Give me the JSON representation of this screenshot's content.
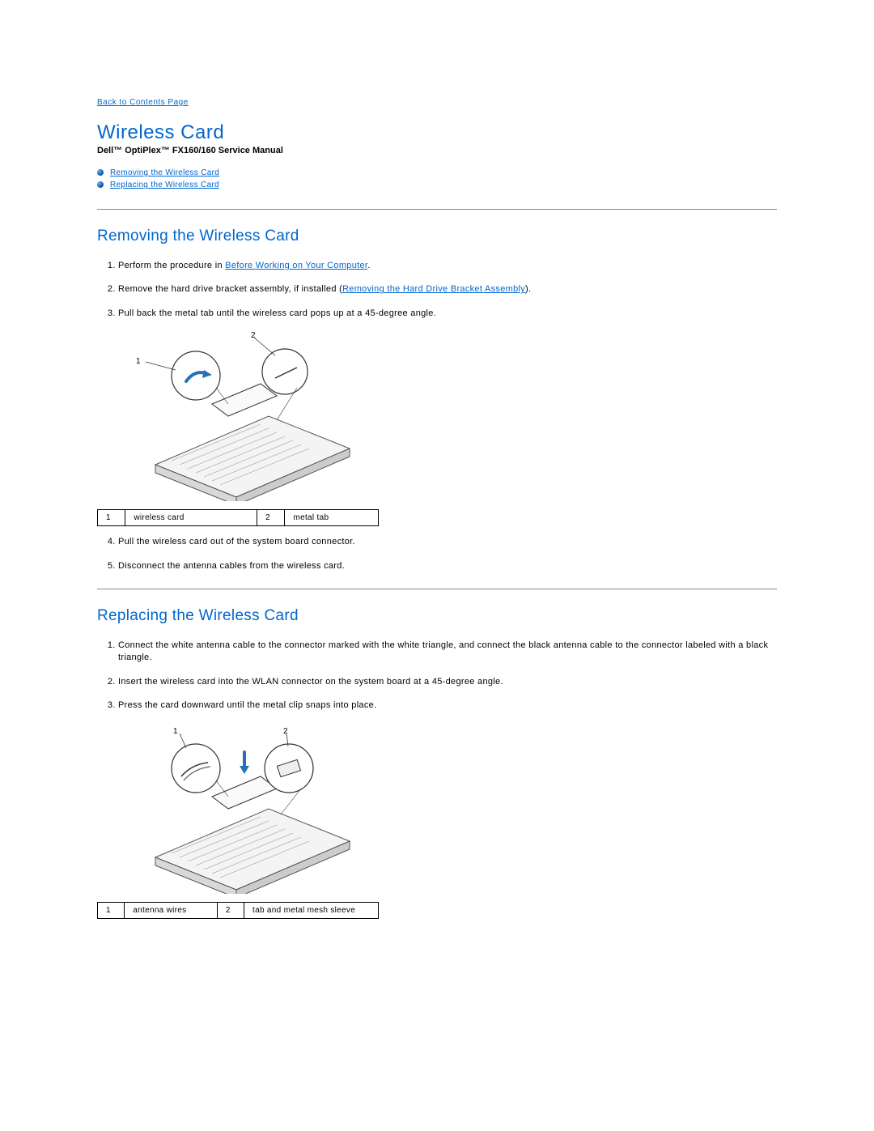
{
  "back_link": "Back to Contents Page",
  "title": "Wireless Card",
  "subtitle": "Dell™ OptiPlex™ FX160/160 Service Manual",
  "toc": {
    "item1": "Removing the Wireless Card",
    "item2": "Replacing the Wireless Card"
  },
  "section1": {
    "heading": "Removing the Wireless Card",
    "step1a": "Perform the procedure in ",
    "step1_link": "Before Working on Your Computer",
    "step1b": ".",
    "step2a": "Remove the hard drive bracket assembly, if installed (",
    "step2_link": "Removing the Hard Drive Bracket Assembly",
    "step2b": ").",
    "step3": "Pull back the metal tab until the wireless card pops up at a 45-degree angle.",
    "legend": {
      "n1": "1",
      "v1": "wireless card",
      "n2": "2",
      "v2": "metal tab"
    },
    "step4": "Pull the wireless card out of the system board connector.",
    "step5": "Disconnect the antenna cables from the wireless card."
  },
  "section2": {
    "heading": "Replacing the Wireless Card",
    "step1": "Connect the white antenna cable to the connector marked with the white triangle, and connect the black antenna cable to the connector labeled with a black triangle.",
    "step2": "Insert the wireless card into the WLAN connector on the system board at a 45-degree angle.",
    "step3": "Press the card downward until the metal clip snaps into place.",
    "legend": {
      "n1": "1",
      "v1": "antenna wires",
      "n2": "2",
      "v2": "tab and metal mesh sleeve"
    }
  },
  "callouts": {
    "c1": "1",
    "c2": "2"
  }
}
